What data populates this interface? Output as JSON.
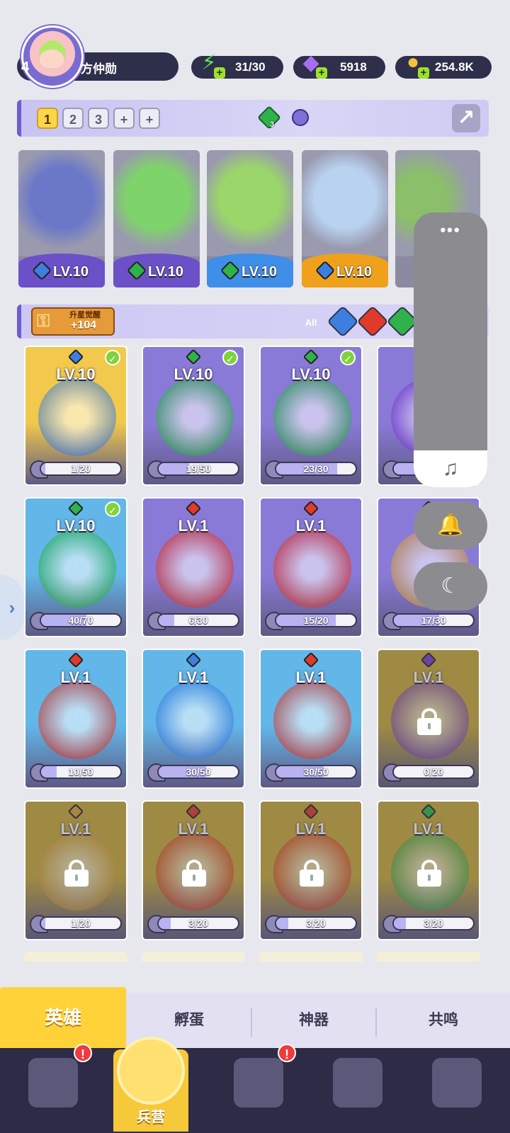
{
  "player": {
    "level": "4",
    "name": "方仲勋"
  },
  "resources": {
    "energy": "31/30",
    "gems": "5918",
    "coins": "254.8K"
  },
  "team_tabs": [
    "1",
    "2",
    "3",
    "+",
    "+"
  ],
  "team_count": "3",
  "team": [
    {
      "level": "LV.10",
      "element": "water",
      "color": "#3d7fe0",
      "stars": ""
    },
    {
      "level": "LV.10",
      "element": "wind",
      "color": "#2fb24a",
      "stars": "★★"
    },
    {
      "level": "LV.10",
      "element": "wind",
      "color": "#2fb24a",
      "stars": "★★★"
    },
    {
      "level": "LV.10",
      "element": "water",
      "color": "#3d7fe0",
      "stars": ""
    }
  ],
  "awaken": {
    "title": "升星觉醒",
    "value": "+104"
  },
  "filters": {
    "all": "All"
  },
  "heroes": [
    {
      "level": "LV.10",
      "progress": "1/20",
      "element": "water",
      "checked": true,
      "locked": false,
      "bg": "#f2c94c",
      "progress_fraction": 0.05
    },
    {
      "level": "LV.10",
      "progress": "19/50",
      "element": "wind",
      "checked": true,
      "locked": false,
      "bg": "#8a7ad8",
      "progress_fraction": 0.38
    },
    {
      "level": "LV.10",
      "progress": "23/30",
      "element": "wind",
      "checked": true,
      "locked": false,
      "bg": "#8a7ad8",
      "progress_fraction": 0.77
    },
    {
      "level": "",
      "progress": "",
      "element": "dark",
      "checked": false,
      "locked": false,
      "bg": "#8a7ad8",
      "progress_fraction": 0.5
    },
    {
      "level": "LV.10",
      "progress": "40/70",
      "element": "wind",
      "checked": true,
      "locked": false,
      "bg": "#62b7e8",
      "progress_fraction": 0.57
    },
    {
      "level": "LV.1",
      "progress": "6/30",
      "element": "fire",
      "checked": false,
      "locked": false,
      "bg": "#8a7ad8",
      "progress_fraction": 0.2
    },
    {
      "level": "LV.1",
      "progress": "15/20",
      "element": "fire",
      "checked": false,
      "locked": false,
      "bg": "#8a7ad8",
      "progress_fraction": 0.75
    },
    {
      "level": "",
      "progress": "17/30",
      "element": "light",
      "checked": false,
      "locked": false,
      "bg": "#8a7ad8",
      "progress_fraction": 0.57
    },
    {
      "level": "LV.1",
      "progress": "10/50",
      "element": "fire",
      "checked": false,
      "locked": false,
      "bg": "#62b7e8",
      "progress_fraction": 0.2
    },
    {
      "level": "LV.1",
      "progress": "30/50",
      "element": "water",
      "checked": false,
      "locked": false,
      "bg": "#62b7e8",
      "progress_fraction": 0.6
    },
    {
      "level": "LV.1",
      "progress": "30/50",
      "element": "fire",
      "checked": false,
      "locked": false,
      "bg": "#62b7e8",
      "progress_fraction": 0.6
    },
    {
      "level": "LV.1",
      "progress": "0/20",
      "element": "dark",
      "checked": false,
      "locked": true,
      "bg": "#c9a93a",
      "progress_fraction": 0
    },
    {
      "level": "LV.1",
      "progress": "1/20",
      "element": "light",
      "checked": false,
      "locked": true,
      "bg": "#c9a93a",
      "progress_fraction": 0.05
    },
    {
      "level": "LV.1",
      "progress": "3/20",
      "element": "fire",
      "checked": false,
      "locked": true,
      "bg": "#c9a93a",
      "progress_fraction": 0.15
    },
    {
      "level": "LV.1",
      "progress": "3/20",
      "element": "fire",
      "checked": false,
      "locked": true,
      "bg": "#c9a93a",
      "progress_fraction": 0.15
    },
    {
      "level": "LV.1",
      "progress": "3/20",
      "element": "wind",
      "checked": false,
      "locked": true,
      "bg": "#c9a93a",
      "progress_fraction": 0.15
    }
  ],
  "element_colors": {
    "water": "#3d7fe0",
    "wind": "#2fb24a",
    "fire": "#e03a2a",
    "dark": "#7a3fd0",
    "light": "#d8a23a"
  },
  "sub_tabs": [
    "英雄",
    "孵蛋",
    "神器",
    "共鸣"
  ],
  "nav": {
    "active_label": "兵营"
  },
  "icons": {
    "energy": "lightning-icon",
    "gems": "diamond-icon",
    "coins": "coin-icon",
    "share": "share-icon",
    "music": "music-note-icon",
    "bell": "bell-icon",
    "moon": "moon-icon"
  }
}
